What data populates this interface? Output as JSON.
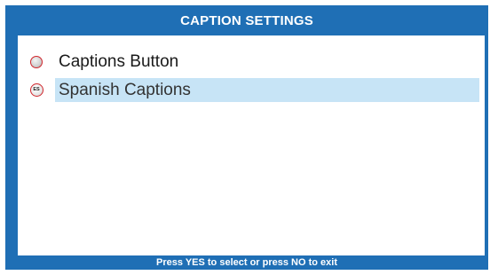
{
  "dialog": {
    "title": "CAPTION SETTINGS",
    "footer": "Press YES to select or press NO to exit"
  },
  "menu": {
    "items": [
      {
        "label": "Captions Button",
        "icon": "captions-circle-icon",
        "selected": false
      },
      {
        "label": "Spanish Captions",
        "icon": "spanish-es-icon",
        "icon_text": "ES",
        "selected": true
      }
    ]
  },
  "colors": {
    "frame": "#1f6fb5",
    "highlight": "#c7e4f6",
    "icon_border": "#d1262c"
  }
}
